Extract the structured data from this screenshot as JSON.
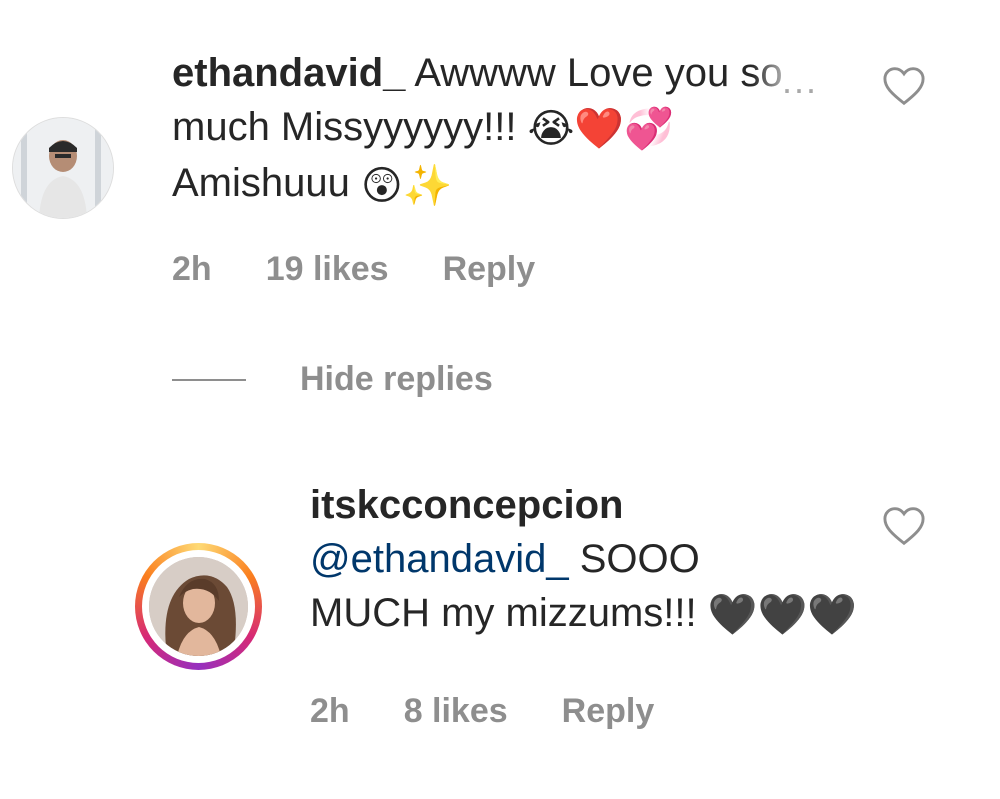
{
  "comments": [
    {
      "username": "ethandavid_",
      "line1": "Awwww Love you so",
      "line2": "much Missyyyyyy!!!",
      "line2_emojis": "😭❤️💞",
      "line3": "Amishuuu",
      "line3_emojis": "😲✨",
      "time": "2h",
      "likes": "19 likes",
      "reply": "Reply"
    }
  ],
  "hide_replies_label": "Hide replies",
  "replies": [
    {
      "username": "itskcconcepcion",
      "mention": "@ethandavid_",
      "line1_rest": "SOOO",
      "line2": "MUCH my mizzums!!!",
      "line2_emojis": "🖤🖤🖤",
      "time": "2h",
      "likes": "8 likes",
      "reply": "Reply"
    }
  ],
  "more_icon": "...",
  "icons": {
    "more": "more-options-icon",
    "like": "heart-outline-icon"
  },
  "colors": {
    "text": "#262626",
    "meta": "#8e8e8e",
    "mention": "#00376b",
    "story_ring": "#d62976"
  }
}
